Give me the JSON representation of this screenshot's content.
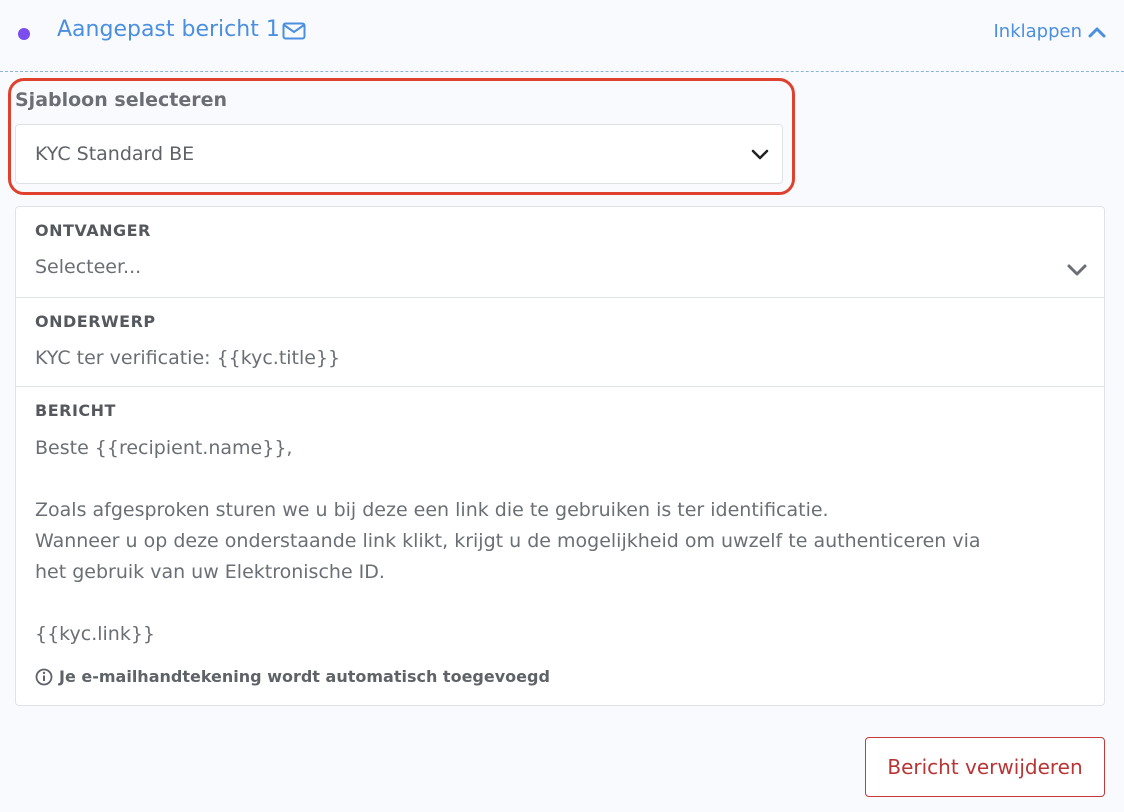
{
  "header": {
    "title": "Aangepast bericht 1",
    "collapse_label": "Inklappen",
    "status_dot_color": "#7c4dee",
    "accent_color": "#4a8fe0"
  },
  "template": {
    "label": "Sjabloon selecteren",
    "selected": "KYC Standard BE",
    "highlight_color": "#e0412f"
  },
  "recipient": {
    "label": "ONTVANGER",
    "placeholder": "Selecteer..."
  },
  "subject": {
    "label": "ONDERWERP",
    "value": "KYC ter verificatie: {{kyc.title}}"
  },
  "message": {
    "label": "BERICHT",
    "body": "Beste {{recipient.name}},\n\nZoals afgesproken sturen we u bij deze een link die te gebruiken is ter identificatie.\nWanneer u op deze onderstaande link klikt, krijgt u de mogelijkheid om uwzelf te authenticeren via\nhet gebruik van uw Elektronische ID.\n\n{{kyc.link}}",
    "signature_note": "Je e-mailhandtekening wordt automatisch toegevoegd"
  },
  "actions": {
    "delete_label": "Bericht verwijderen",
    "delete_color": "#b83535"
  }
}
